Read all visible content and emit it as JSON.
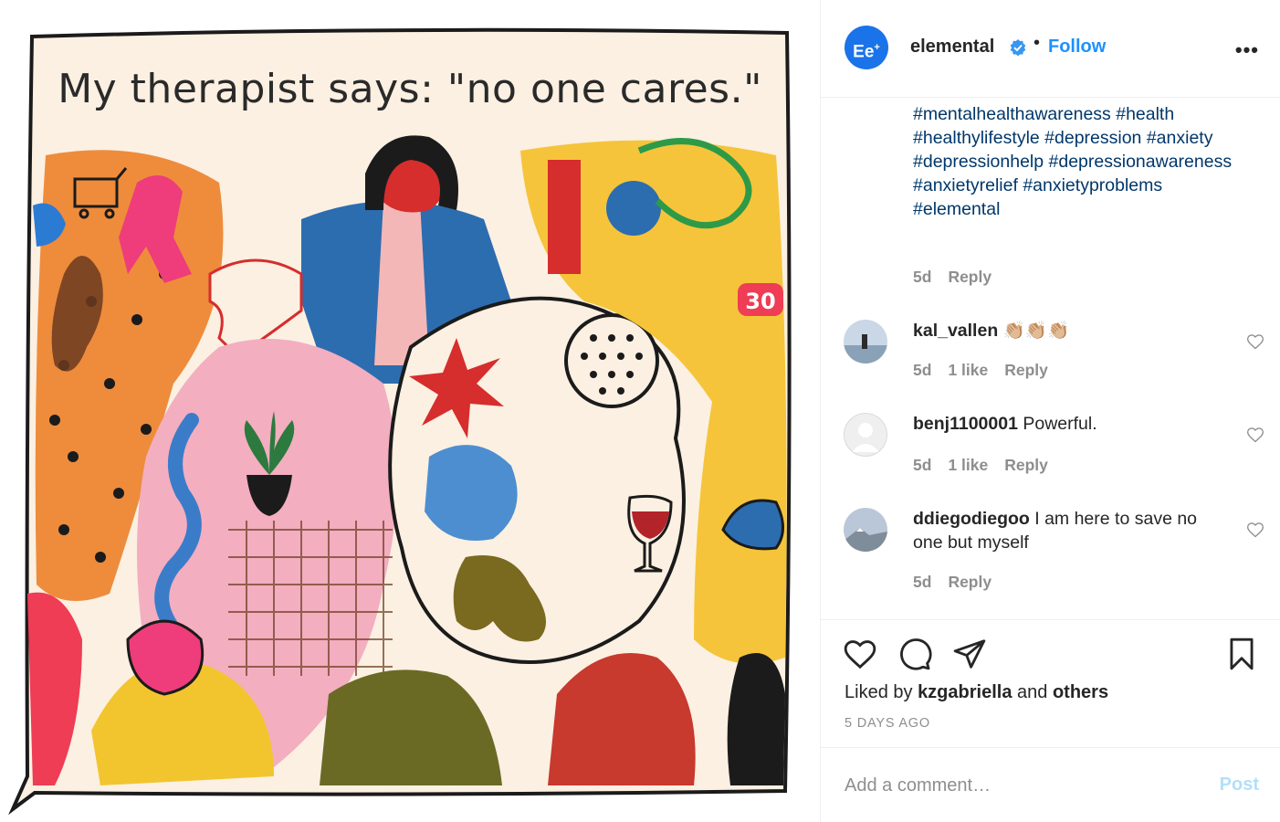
{
  "post": {
    "image_caption_text": "My therapist says: \"no one cares.\""
  },
  "header": {
    "avatar_text": "Ee",
    "avatar_sup": "+",
    "username": "elemental",
    "separator": "•",
    "follow_label": "Follow",
    "more_label": "•••"
  },
  "caption": {
    "hashtags": "#mentalhealthawareness #health #healthylifestyle #depression #anxiety #depressionhelp #depressionawareness #anxietyrelief #anxietyproblems #elemental",
    "time": "5d",
    "reply_label": "Reply"
  },
  "comments": [
    {
      "username": "kal_vallen",
      "text": "👏🏼👏🏼👏🏼",
      "time": "5d",
      "likes": "1 like",
      "reply_label": "Reply"
    },
    {
      "username": "benj1100001",
      "text": "Powerful.",
      "time": "5d",
      "likes": "1 like",
      "reply_label": "Reply"
    },
    {
      "username": "ddiegodiegoo",
      "text": "I am here to save no one but myself",
      "time": "5d",
      "likes": "",
      "reply_label": "Reply"
    }
  ],
  "footer": {
    "liked_prefix": "Liked by",
    "liked_user": "kzgabriella",
    "liked_and": "and",
    "liked_others": "others",
    "time_ago": "5 DAYS AGO",
    "comment_placeholder": "Add a comment…",
    "post_label": "Post"
  },
  "colors": {
    "link_blue": "#1e90ff",
    "hashtag_blue": "#00376b",
    "muted_gray": "#8e8e8e",
    "post_disabled": "#b2dffc"
  }
}
